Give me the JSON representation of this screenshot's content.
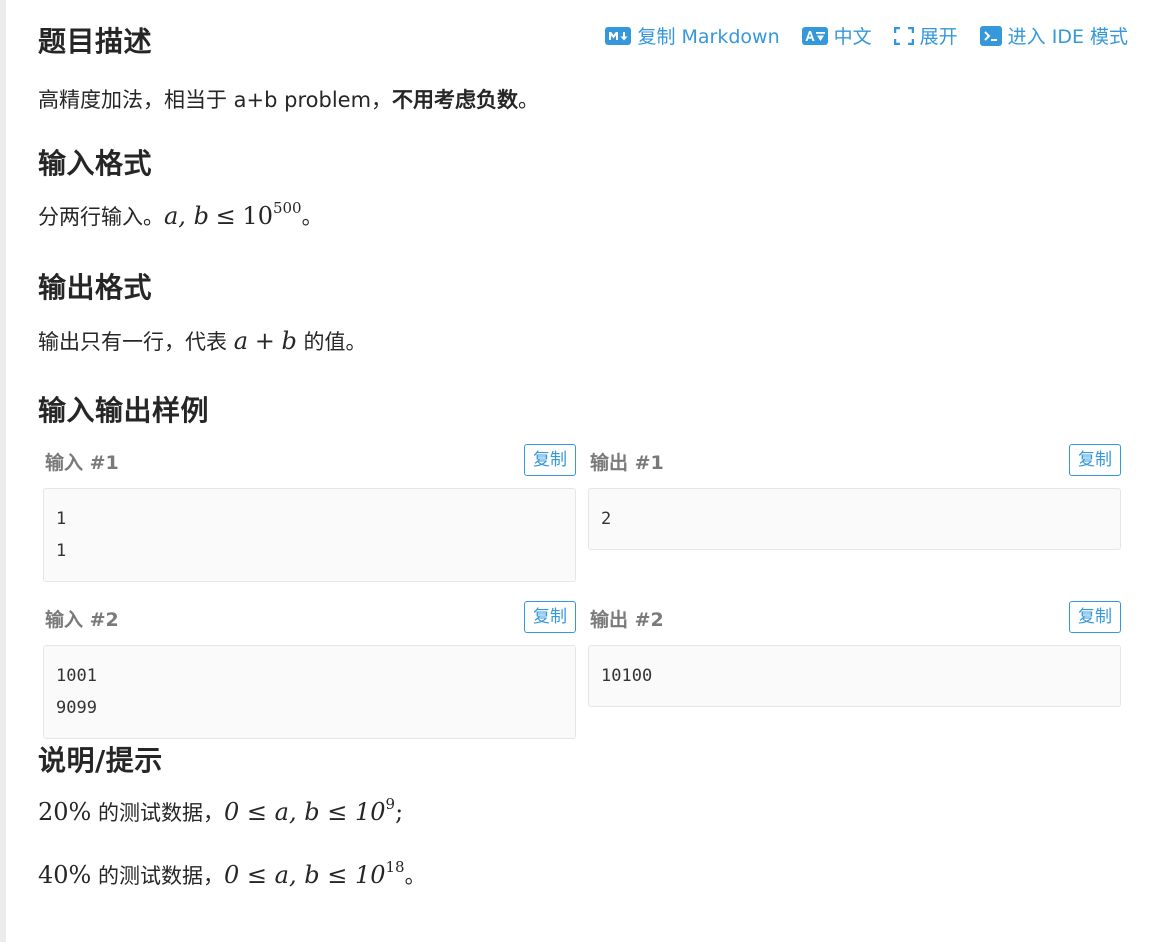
{
  "description": {
    "title": "题目描述",
    "text_normal": "高精度加法，相当于 a+b problem，",
    "text_bold": "不用考虑负数",
    "text_end": "。"
  },
  "toolbar": {
    "copy_markdown": "复制 Markdown",
    "language": "中文",
    "expand": "展开",
    "ide_mode": "进入 IDE 模式",
    "md_icon_text": "M↓",
    "lang_icon_text": "A文"
  },
  "input_format": {
    "title": "输入格式",
    "text_prefix": "分两行输入。",
    "math_vars": "a, b",
    "math_op": "≤",
    "math_base": "10",
    "math_exp": "500",
    "text_end": "。"
  },
  "output_format": {
    "title": "输出格式",
    "text_prefix": "输出只有一行，代表",
    "math_a": "a",
    "math_plus": "+",
    "math_b": "b",
    "text_suffix": "的值。"
  },
  "samples": {
    "title": "输入输出样例",
    "copy_label": "复制",
    "items": [
      {
        "input_label": "输入 #1",
        "input_lines": [
          "1",
          "1"
        ],
        "output_label": "输出 #1",
        "output_lines": [
          "2"
        ]
      },
      {
        "input_label": "输入 #2",
        "input_lines": [
          "1001",
          "9099"
        ],
        "output_label": "输出 #2",
        "output_lines": [
          "10100"
        ]
      }
    ]
  },
  "hint": {
    "title": "说明/提示",
    "lines": [
      {
        "percent": "20%",
        "text": "的测试数据，",
        "math": "0 ≤ a, b ≤ 10",
        "exp": "9",
        "end": ";"
      },
      {
        "percent": "40%",
        "text": "的测试数据，",
        "math": "0 ≤ a, b ≤ 10",
        "exp": "18",
        "end": "。"
      }
    ]
  },
  "colors": {
    "accent": "#3498db",
    "text": "#262626",
    "label_gray": "#7a7a7a",
    "code_bg": "#fafafa"
  }
}
